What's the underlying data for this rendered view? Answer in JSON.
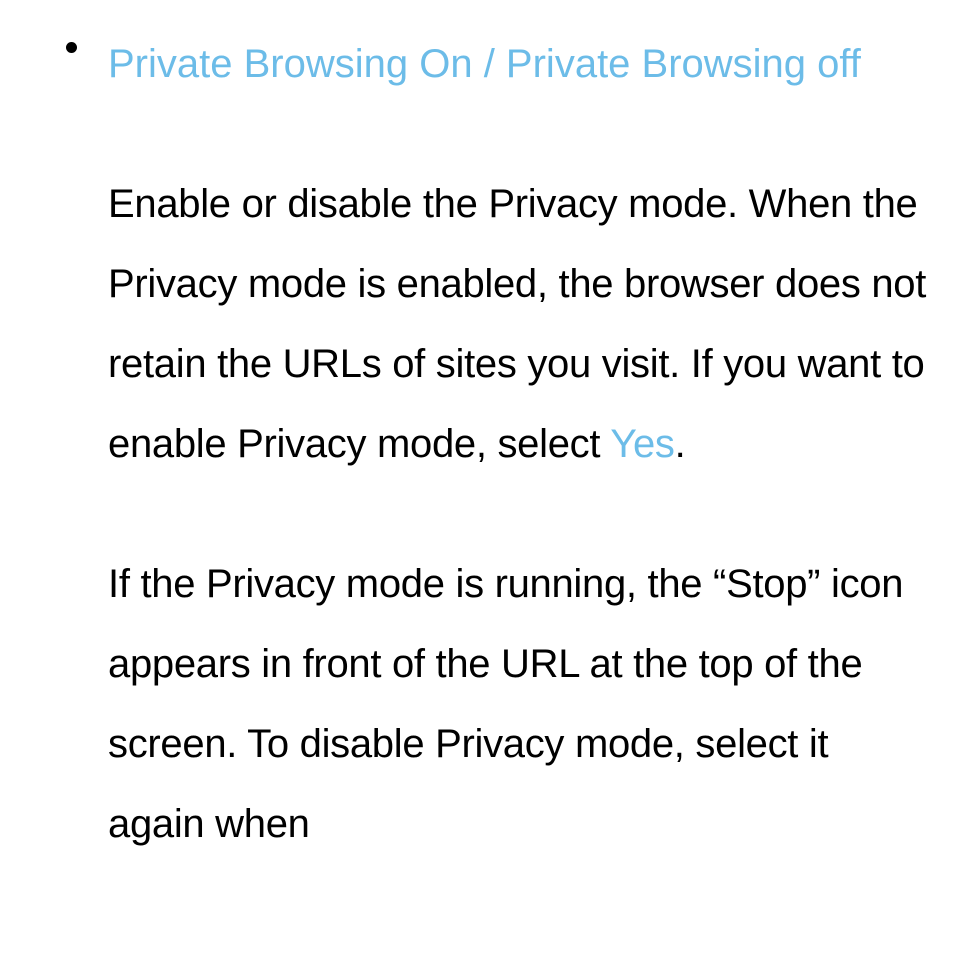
{
  "item": {
    "title": "Private Browsing On / Private Browsing off",
    "para1_a": "Enable or disable the Privacy mode. When the Privacy mode is enabled, the browser does not retain the URLs of sites you visit. If you want to enable Privacy mode, select ",
    "para1_yes": "Yes",
    "para1_b": ".",
    "para2": "If the Privacy mode is running, the “Stop” icon appears in front of the URL at the top of the screen. To disable Privacy mode, select it again when"
  }
}
